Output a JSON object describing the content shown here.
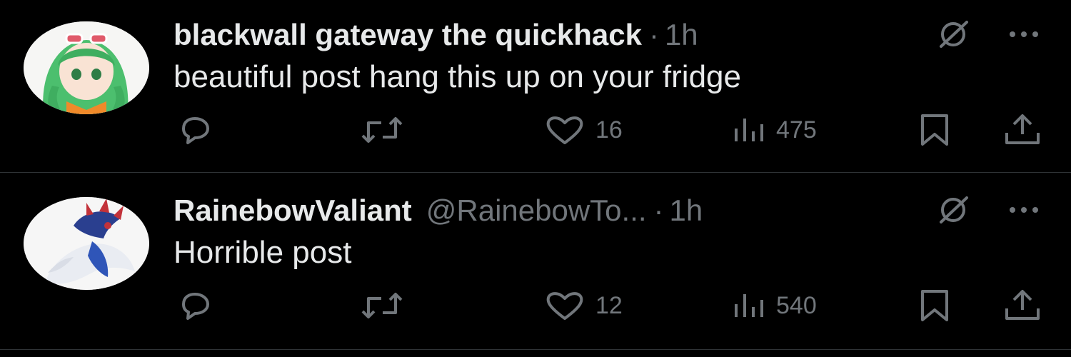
{
  "posts": [
    {
      "display_name": "blackwall gateway the quickhack",
      "handle": "",
      "dot": "·",
      "time": "1h",
      "text": "beautiful post hang this up on your fridge",
      "likes": "16",
      "views": "475",
      "avatar_icon": "anime-avatar-green-hair"
    },
    {
      "display_name": "RainebowValiant",
      "handle": "@RainebowTo...",
      "dot": "·",
      "time": "1h",
      "text": "Horrible post",
      "likes": "12",
      "views": "540",
      "avatar_icon": "creature-avatar-blue"
    }
  ],
  "icons": {
    "reply": "reply-icon",
    "repost": "repost-icon",
    "like": "heart-icon",
    "views": "views-icon",
    "bookmark": "bookmark-icon",
    "share": "share-icon",
    "grok": "grok-icon",
    "more": "more-icon"
  },
  "colors": {
    "background": "#000000",
    "text": "#e7e9ea",
    "secondary": "#71767b",
    "divider": "#2f3336"
  }
}
